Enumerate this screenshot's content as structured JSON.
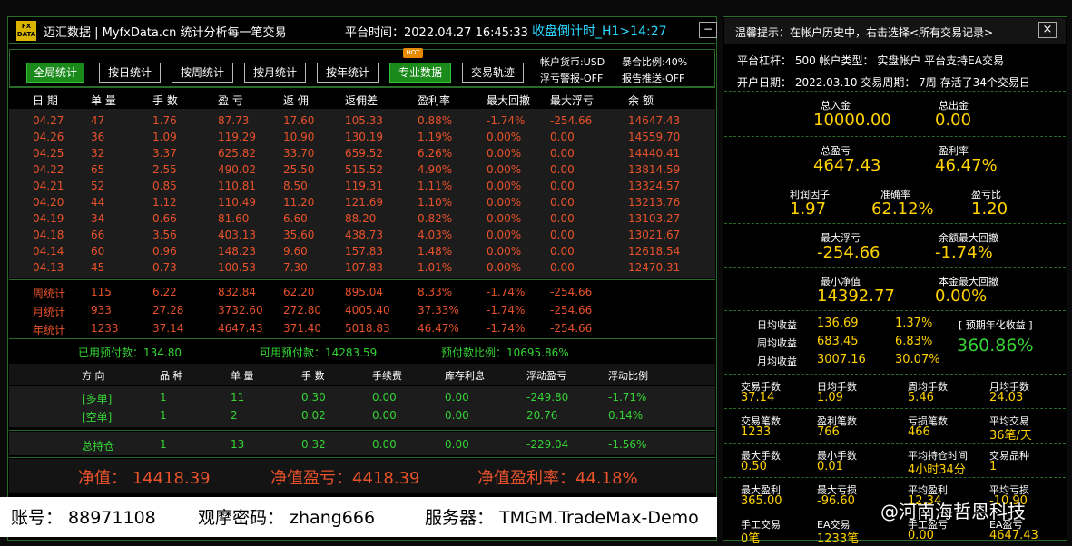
{
  "header": {
    "logo": "FX DATA",
    "title": "迈汇数据 | MyfxData.cn  统计分析每一笔交易",
    "platform_time": "平台时间：2022.04.27 16:45:33",
    "countdown": "收盘倒计时_H1>14:27",
    "min_btn": "−"
  },
  "buttons": [
    {
      "label": "全局统计",
      "active": true
    },
    {
      "label": "按日统计"
    },
    {
      "label": "按周统计"
    },
    {
      "label": "按月统计"
    },
    {
      "label": "按年统计"
    },
    {
      "label": "专业数据",
      "active": true
    },
    {
      "label": "交易轨迹"
    }
  ],
  "hot": "HOT",
  "info": {
    "currency": "帐户货币:USD",
    "ratio": "暴合比例:40%",
    "float_alert": "浮亏警报-OFF",
    "report": "报告推送-OFF"
  },
  "table_headers": [
    "日 期",
    "单 量",
    "手 数",
    "盈 亏",
    "返 佣",
    "返佣差",
    "盈利率",
    "最大回撤",
    "最大浮亏",
    "余 额"
  ],
  "rows": [
    [
      "04.27",
      "47",
      "1.76",
      "87.73",
      "17.60",
      "105.33",
      "0.88%",
      "-1.74%",
      "-254.66",
      "14647.43"
    ],
    [
      "04.26",
      "36",
      "1.09",
      "119.29",
      "10.90",
      "130.19",
      "1.19%",
      "0.00%",
      "0.00",
      "14559.70"
    ],
    [
      "04.25",
      "32",
      "3.37",
      "625.82",
      "33.70",
      "659.52",
      "6.26%",
      "0.00%",
      "0.00",
      "14440.41"
    ],
    [
      "04.22",
      "65",
      "2.55",
      "490.02",
      "25.50",
      "515.52",
      "4.90%",
      "0.00%",
      "0.00",
      "13814.59"
    ],
    [
      "04.21",
      "52",
      "0.85",
      "110.81",
      "8.50",
      "119.31",
      "1.11%",
      "0.00%",
      "0.00",
      "13324.57"
    ],
    [
      "04.20",
      "44",
      "1.12",
      "110.49",
      "11.20",
      "121.69",
      "1.10%",
      "0.00%",
      "0.00",
      "13213.76"
    ],
    [
      "04.19",
      "34",
      "0.66",
      "81.60",
      "6.60",
      "88.20",
      "0.82%",
      "0.00%",
      "0.00",
      "13103.27"
    ],
    [
      "04.18",
      "66",
      "3.56",
      "403.13",
      "35.60",
      "438.73",
      "4.03%",
      "0.00%",
      "0.00",
      "13021.67"
    ],
    [
      "04.14",
      "60",
      "0.96",
      "148.23",
      "9.60",
      "157.83",
      "1.48%",
      "0.00%",
      "0.00",
      "12618.54"
    ],
    [
      "04.13",
      "45",
      "0.73",
      "100.53",
      "7.30",
      "107.83",
      "1.01%",
      "0.00%",
      "0.00",
      "12470.31"
    ]
  ],
  "summary": [
    [
      "周统计",
      "115",
      "6.22",
      "832.84",
      "62.20",
      "895.04",
      "8.33%",
      "-1.74%",
      "-254.66"
    ],
    [
      "月统计",
      "933",
      "27.28",
      "3732.60",
      "272.80",
      "4005.40",
      "37.33%",
      "-1.74%",
      "-254.66"
    ],
    [
      "年统计",
      "1233",
      "37.14",
      "4647.43",
      "371.40",
      "5018.83",
      "46.47%",
      "-1.74%",
      "-254.66"
    ]
  ],
  "margin": {
    "used": "已用预付款：134.80",
    "free": "可用预付款：14283.59",
    "ratio": "预付款比例：10695.86%"
  },
  "pos_headers": [
    "方 向",
    "品 种",
    "单 量",
    "手 数",
    "手续费",
    "库存利息",
    "浮动盈亏",
    "浮动比例"
  ],
  "positions": [
    [
      "[多单]",
      "1",
      "11",
      "0.30",
      "0.00",
      "0.00",
      "-249.80",
      "-1.71%"
    ],
    [
      "[空单]",
      "1",
      "2",
      "0.02",
      "0.00",
      "0.00",
      "20.76",
      "0.14%"
    ]
  ],
  "total": [
    "总持仓",
    "1",
    "13",
    "0.32",
    "0.00",
    "0.00",
    "-229.04",
    "-1.56%"
  ],
  "equity": {
    "net": "净值： 14418.39",
    "profit": "净值盈亏：4418.39",
    "rate": "净值盈利率：44.18%"
  },
  "account": {
    "acct": "账号：  88971108",
    "pwd": "观摩密码：  zhang666",
    "server": "服务器：  TMGM.TradeMax-Demo"
  },
  "right": {
    "tip": "温馨提示：在帐户历史中，右击选择<所有交易记录>",
    "close": "×",
    "line1": "平台杠杆：  500      帐户类型：  实盘帐户      平台支持EA交易",
    "line2": "开户日期：  2022.03.10      交易周期：  7周      存活了34个交易日",
    "dep_l": "总入金",
    "dep": "10000.00",
    "wd_l": "总出金",
    "wd": "0.00",
    "pl_l": "总盈亏",
    "pl": "4647.43",
    "pr_l": "盈利率",
    "pr": "46.47%",
    "pf_l": "利润因子",
    "pf": "1.97",
    "acc_l": "准确率",
    "acc": "62.12%",
    "rr_l": "盈亏比",
    "rr": "1.20",
    "mf_l": "最大浮亏",
    "mf": "-254.66",
    "md_l": "余额最大回撤",
    "md": "-1.74%",
    "mn_l": "最小净值",
    "mn": "14392.77",
    "bd_l": "本金最大回撤",
    "bd": "0.00%",
    "d_l": "日均收益",
    "d_v": "136.69",
    "d_p": "1.37%",
    "w_l": "周均收益",
    "w_v": "683.45",
    "w_p": "6.83%",
    "m_l": "月均收益",
    "m_v": "3007.16",
    "m_p": "30.07%",
    "ann_l": "[ 预期年化收益 ]",
    "ann": "360.86%",
    "grid": [
      [
        "交易手数",
        "37.14",
        "日均手数",
        "1.09",
        "周均手数",
        "5.46",
        "月均手数",
        "24.03"
      ],
      [
        "交易笔数",
        "1233",
        "盈利笔数",
        "766",
        "亏损笔数",
        "466",
        "平均交易",
        "36笔/天"
      ],
      [
        "最大手数",
        "0.50",
        "最小手数",
        "0.01",
        "平均持仓时间",
        "4小时34分",
        "交易品种",
        "1"
      ],
      [
        "最大盈利",
        "365.00",
        "最大亏损",
        "-96.60",
        "平均盈利",
        "12.34",
        "平均亏损",
        "-10.90"
      ],
      [
        "手工交易",
        "0笔",
        "EA交易",
        "1233笔",
        "手工盈亏",
        "0.00",
        "EA盈亏",
        "4647.43"
      ]
    ]
  },
  "watermark": "@河南海哲恩科技"
}
